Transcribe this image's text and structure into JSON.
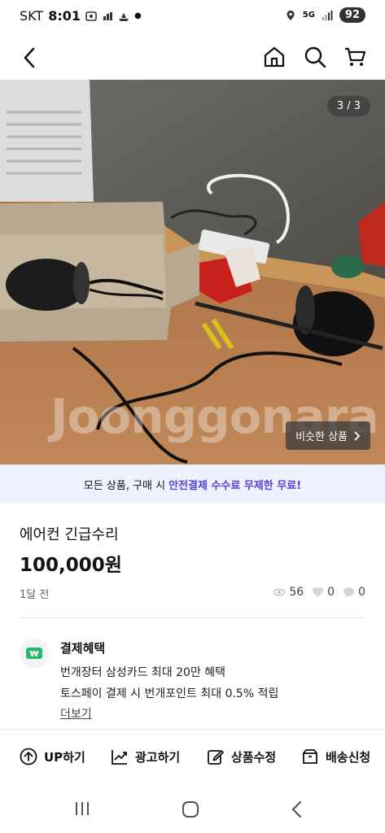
{
  "status": {
    "carrier": "SKT",
    "time": "8:01",
    "network": "5G",
    "battery": "92"
  },
  "photo": {
    "counter": "3 / 3",
    "watermark": "Joonggonara",
    "similar_label": "비슷한 상품"
  },
  "promo": {
    "text": "모든 상품, 구매 시",
    "highlight": "안전결제 수수료 무제한 무료!"
  },
  "product": {
    "title": "에어컨 긴급수리",
    "price": "100,000원",
    "posted": "1달 전",
    "views": "56",
    "likes": "0",
    "chats": "0"
  },
  "benefit": {
    "title": "결제혜택",
    "line1": "번개장터 삼성카드 최대 20만 혜택",
    "line2": "토스페이 결제 시 번개포인트 최대 0.5% 적립",
    "more": "더보기"
  },
  "actions": {
    "up": "UP하기",
    "ad": "광고하기",
    "edit": "상품수정",
    "shipping": "배송신청"
  }
}
